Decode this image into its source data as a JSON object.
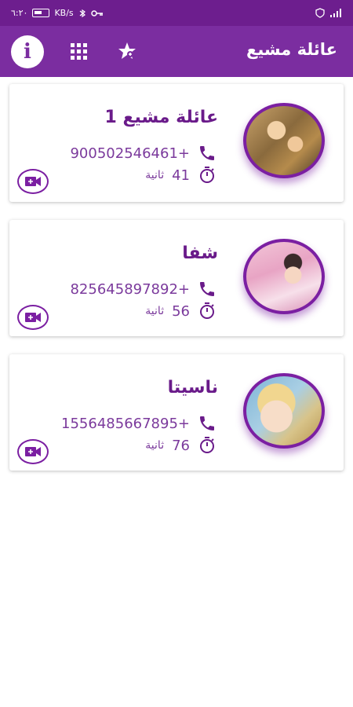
{
  "status_bar": {
    "time": "٦:٢٠",
    "network_speed": "KB/s"
  },
  "appbar": {
    "title": "عائلة مشيع",
    "info_icon": "info-icon",
    "grid_icon": "grid-icon",
    "star_icon": "star-icon"
  },
  "contacts": [
    {
      "name": "عائلة مشيع 1",
      "phone": "900502546461+",
      "duration_value": "41",
      "duration_unit": "ثانية"
    },
    {
      "name": "شفا",
      "phone": "825645897892+",
      "duration_value": "56",
      "duration_unit": "ثانية"
    },
    {
      "name": "ناسيتا",
      "phone": "1556485667895+",
      "duration_value": "76",
      "duration_unit": "ثانية"
    }
  ],
  "colors": {
    "appbar": "#7b2da0",
    "statusbar": "#6d1e8e",
    "accent": "#7b1fa2"
  }
}
